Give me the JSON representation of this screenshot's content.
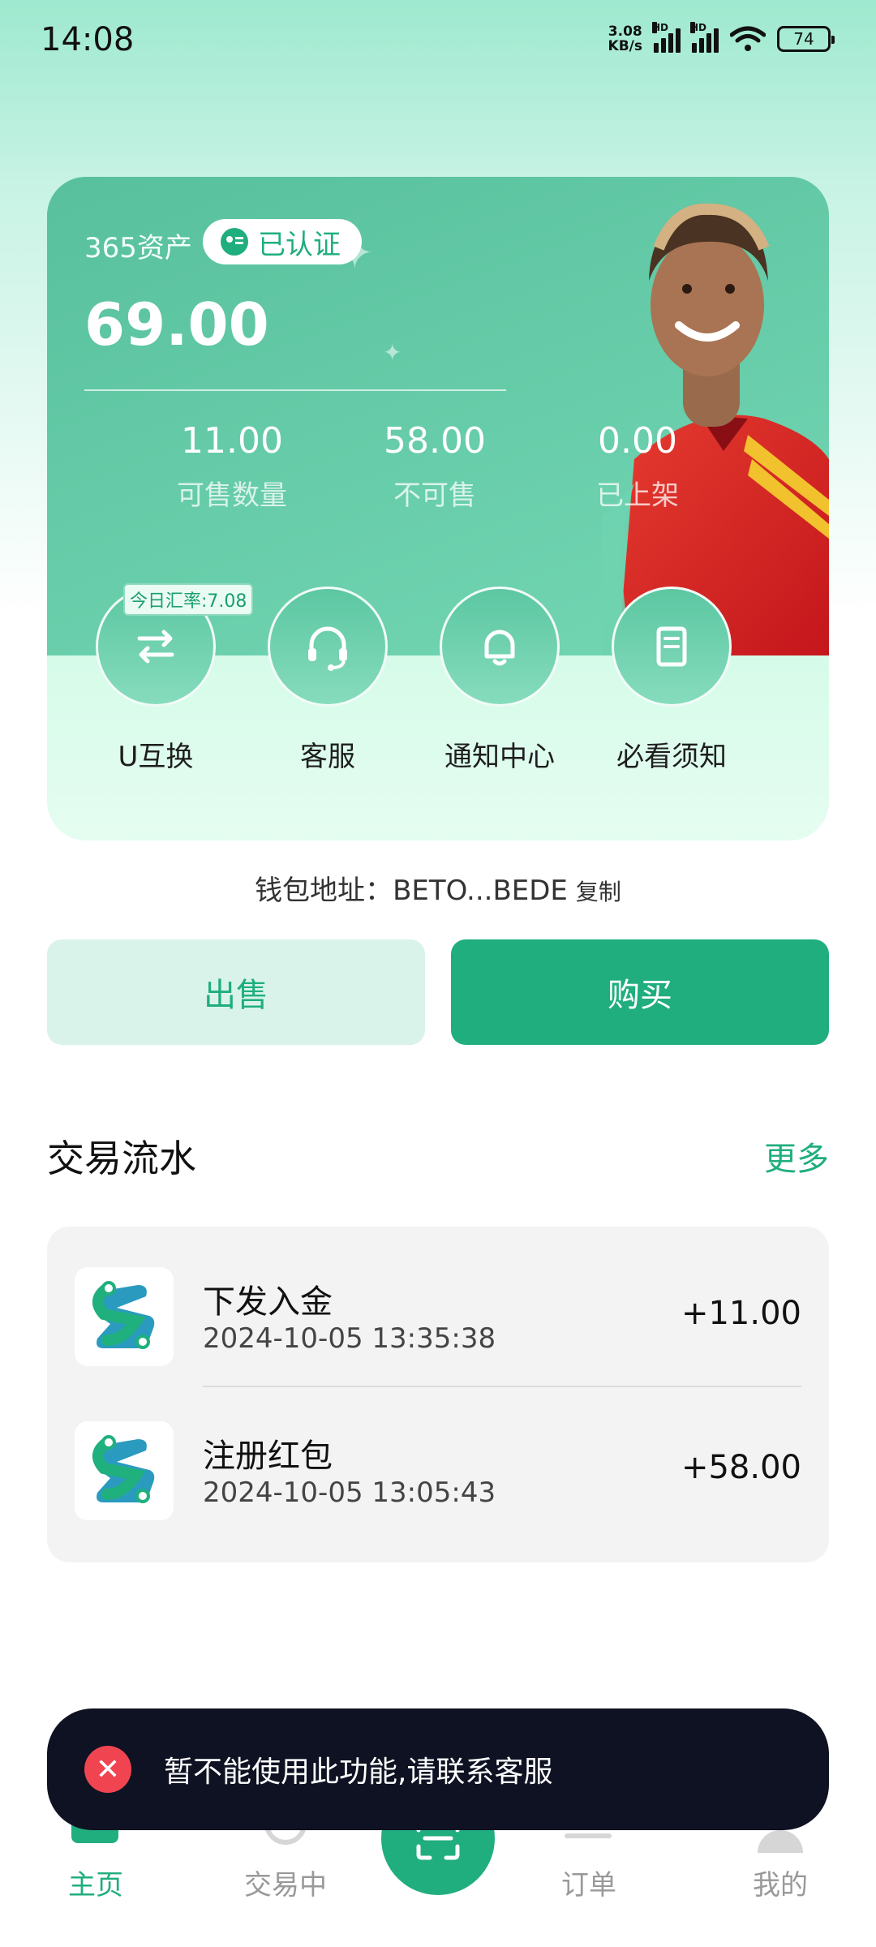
{
  "status_bar": {
    "time": "14:08",
    "net_speed_value": "3.08",
    "net_speed_unit": "KB/s",
    "hd_label": "HD",
    "battery": "74"
  },
  "asset_card": {
    "label": "365资产",
    "verified_label": "已认证",
    "amount": "69.00",
    "stats": [
      {
        "value": "11.00",
        "label": "可售数量"
      },
      {
        "value": "58.00",
        "label": "不可售"
      },
      {
        "value": "0.00",
        "label": "已上架"
      }
    ],
    "rate_badge": "今日汇率:7.08",
    "actions": [
      {
        "label": "U互换",
        "icon": "swap-arrows-icon"
      },
      {
        "label": "客服",
        "icon": "headset-icon"
      },
      {
        "label": "通知中心",
        "icon": "bell-icon"
      },
      {
        "label": "必看须知",
        "icon": "document-icon"
      }
    ]
  },
  "wallet": {
    "label": "钱包地址：",
    "address": "BETO...BEDE",
    "copy_label": "复制"
  },
  "trade_buttons": {
    "sell_label": "出售",
    "buy_label": "购买"
  },
  "transactions": {
    "title": "交易流水",
    "more_label": "更多",
    "items": [
      {
        "name": "下发入金",
        "time": "2024-10-05 13:35:38",
        "amount": "+11.00"
      },
      {
        "name": "注册红包",
        "time": "2024-10-05 13:05:43",
        "amount": "+58.00"
      }
    ]
  },
  "bottom_nav": {
    "items": [
      {
        "label": "主页",
        "icon": "home-icon",
        "active": true
      },
      {
        "label": "交易中",
        "icon": "trade-icon",
        "active": false
      },
      {
        "label": "订单",
        "icon": "order-icon",
        "active": false
      },
      {
        "label": "我的",
        "icon": "profile-icon",
        "active": false
      }
    ],
    "center_icon": "scan-icon"
  },
  "toast": {
    "message": "暂不能使用此功能,请联系客服",
    "icon": "error-icon"
  },
  "colors": {
    "accent": "#20ae7e",
    "toast_bg": "#0e1222",
    "error": "#f04550"
  }
}
